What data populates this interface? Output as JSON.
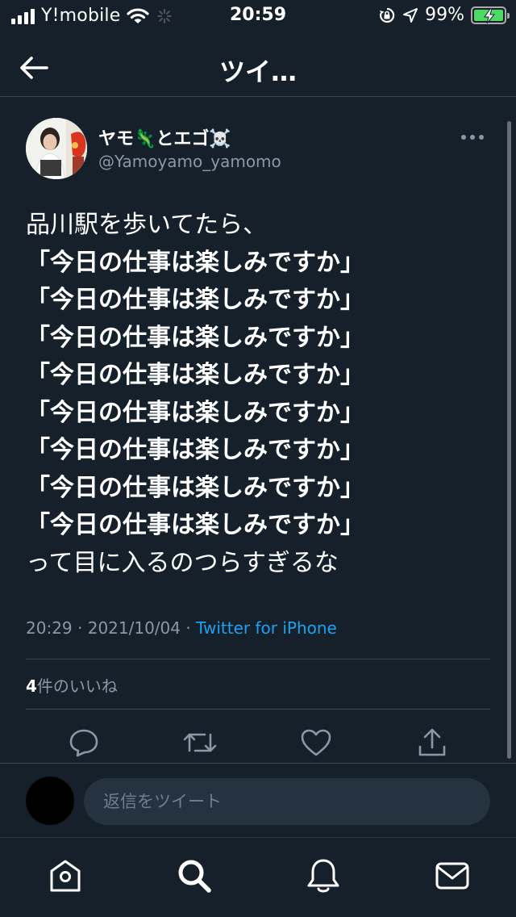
{
  "status_bar": {
    "carrier": "Y!mobile",
    "time": "20:59",
    "battery_percent": "99%",
    "icons": [
      "signal-icon",
      "wifi-icon",
      "activity-spinner-icon",
      "orientation-lock-icon",
      "location-arrow-icon",
      "battery-charging-icon"
    ]
  },
  "nav": {
    "title": "ツイ…",
    "back_icon": "arrow-left-icon"
  },
  "tweet": {
    "display_name": "ヤモ🦎とエゴ☠️",
    "handle": "@Yamoyamo_yamomo",
    "more_icon": "more-horizontal-icon",
    "lines": [
      {
        "text": "品川駅を歩いてたら、",
        "bold": false
      },
      {
        "text": "「今日の仕事は楽しみですか」",
        "bold": true
      },
      {
        "text": "「今日の仕事は楽しみですか」",
        "bold": true
      },
      {
        "text": "「今日の仕事は楽しみですか」",
        "bold": true
      },
      {
        "text": "「今日の仕事は楽しみですか」",
        "bold": true
      },
      {
        "text": "「今日の仕事は楽しみですか」",
        "bold": true
      },
      {
        "text": "「今日の仕事は楽しみですか」",
        "bold": true
      },
      {
        "text": "「今日の仕事は楽しみですか」",
        "bold": true
      },
      {
        "text": "「今日の仕事は楽しみですか」",
        "bold": true
      },
      {
        "text": "って目に入るのつらすぎるな",
        "bold": false
      }
    ],
    "time": "20:29",
    "separator": " · ",
    "date": "2021/10/04",
    "source": "Twitter for iPhone",
    "likes_count": "4",
    "likes_label": "件のいいね"
  },
  "actions": [
    "reply-icon",
    "retweet-icon",
    "like-icon",
    "share-icon"
  ],
  "reply": {
    "placeholder": "返信をツイート"
  },
  "tabbar": [
    "home-icon",
    "search-icon",
    "notifications-icon",
    "messages-icon"
  ],
  "colors": {
    "background": "#15202b",
    "divider": "#38444d",
    "secondary_text": "#8899a6",
    "link": "#1da1f2",
    "input_bg": "#253341",
    "battery": "#4cd964"
  }
}
